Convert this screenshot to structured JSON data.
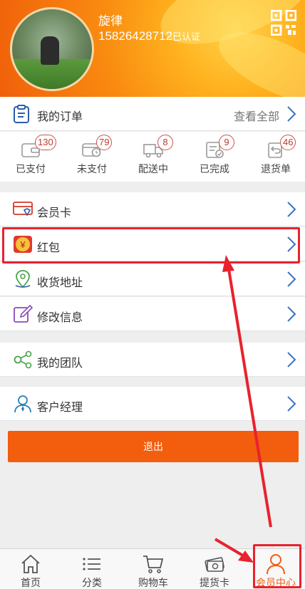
{
  "profile": {
    "username": "旋律",
    "phone": "15826428712",
    "verified_label": "已认证",
    "qr_icon": "qr-code-icon"
  },
  "orders": {
    "title": "我的订单",
    "view_all": "查看全部",
    "stats": [
      {
        "label": "已支付",
        "count": "130",
        "icon": "wallet-icon"
      },
      {
        "label": "未支付",
        "count": "79",
        "icon": "card-clock-icon"
      },
      {
        "label": "配送中",
        "count": "8",
        "icon": "truck-icon"
      },
      {
        "label": "已完成",
        "count": "9",
        "icon": "checklist-icon"
      },
      {
        "label": "退货单",
        "count": "46",
        "icon": "return-icon"
      }
    ]
  },
  "menu": [
    {
      "label": "会员卡",
      "icon": "member-card-icon"
    },
    {
      "label": "红包",
      "icon": "red-envelope-yen-icon",
      "glyph": "¥"
    },
    {
      "label": "收货地址",
      "icon": "location-pin-icon"
    },
    {
      "label": "修改信息",
      "icon": "edit-icon"
    },
    {
      "label": "我的团队",
      "icon": "team-share-icon"
    },
    {
      "label": "客户经理",
      "icon": "manager-icon"
    }
  ],
  "logout_label": "退出",
  "tabs": [
    {
      "label": "首页",
      "icon": "home-icon"
    },
    {
      "label": "分类",
      "icon": "list-icon"
    },
    {
      "label": "购物车",
      "icon": "cart-icon"
    },
    {
      "label": "提货卡",
      "icon": "pickup-card-icon"
    },
    {
      "label": "会员中心",
      "icon": "user-icon",
      "active": true
    }
  ],
  "colors": {
    "accent": "#f25d0e",
    "icon_blue": "#2a5ea8",
    "highlight": "#e8222e"
  }
}
